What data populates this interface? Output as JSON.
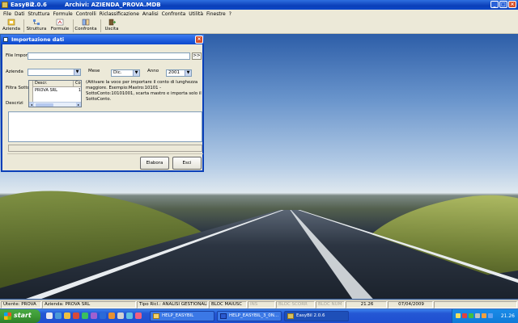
{
  "app": {
    "name": "EasyBil",
    "version": "2.0.6",
    "archive": "Archivi: AZIENDA_PROVA.MDB"
  },
  "menu": [
    "File",
    "Dati",
    "Struttura",
    "Formule",
    "Controlli",
    "Riclassificazione",
    "Analisi",
    "Confronta",
    "Utilità",
    "Finestre",
    "?"
  ],
  "toolbar": {
    "azienda": "Azienda",
    "struttura": "Struttura",
    "formule": "Formule",
    "confronta": "Confronta",
    "uscita": "Uscita"
  },
  "dialog": {
    "title": "Importazione dati",
    "file_label": "File Impor",
    "file_value": "",
    "browse_label": ">>",
    "azienda_label": "Azienda",
    "azienda_value": "",
    "mese_label": "Mese",
    "mese_value": "Dic.",
    "anno_label": "Anno",
    "anno_value": "2001",
    "filtra_label": "Filtra Sotto",
    "descrizione_label": "Descrizi",
    "info": "(Attivare la voce per importare il conto di lunghezza maggiore. Esempio:Mastro:10101 - SottoConto:10101001, scarta mastro e importa solo il SottoConto.",
    "grid": {
      "headers": [
        "Descr.",
        "Co"
      ],
      "rows": [
        [
          "PROVA SRL",
          "1"
        ]
      ]
    },
    "progress": 0,
    "elabora_label": "Elabora",
    "esci_label": "Esci"
  },
  "status": {
    "utente": "Utente: PROVA",
    "azienda": "Azienda: PROVA SRL",
    "tipo": "Tipo Ricl.: ANALISI GESTIONALE",
    "maiusc": "BLOC MAIUSC",
    "ins": "INS",
    "scorr": "BLOC SCORR",
    "num": "BLOC NUM",
    "time": "21.26",
    "date": "07/04/2009"
  },
  "taskbar": {
    "start": "start",
    "tasks": [
      "HELP_EASYBIL",
      "HELP_EASYBIL_3_0N...",
      "EasyBil   2.0.6"
    ],
    "clock": "21.26"
  }
}
